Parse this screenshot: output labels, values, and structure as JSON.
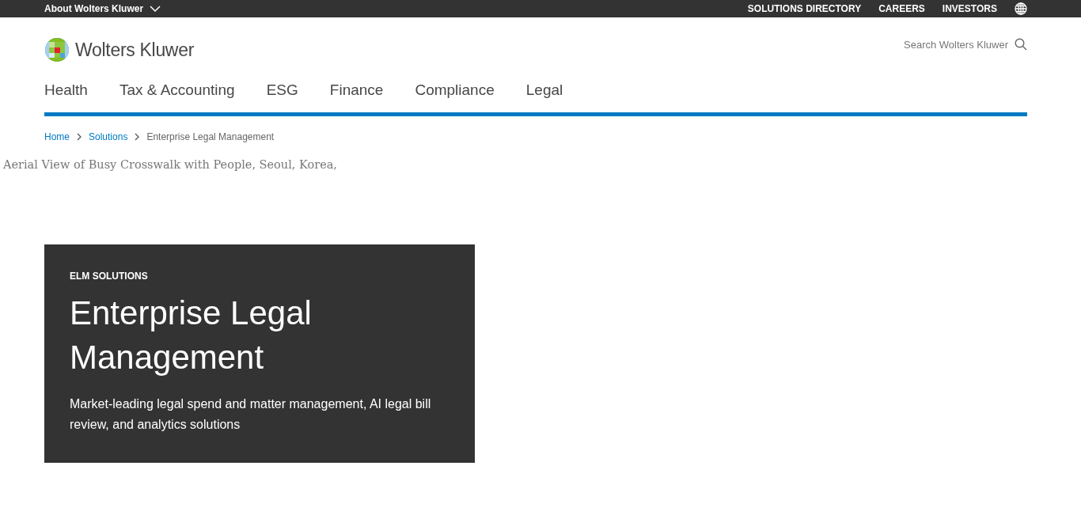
{
  "top_bar": {
    "about": "About Wolters Kluwer",
    "links": [
      "SOLUTIONS DIRECTORY",
      "CAREERS",
      "INVESTORS"
    ]
  },
  "header": {
    "logo_text": "Wolters Kluwer",
    "search": {
      "placeholder": "Search Wolters Kluwer"
    }
  },
  "nav": {
    "items": [
      "Health",
      "Tax & Accounting",
      "ESG",
      "Finance",
      "Compliance",
      "Legal"
    ]
  },
  "breadcrumb": [
    {
      "label": "Home",
      "kind": "link"
    },
    {
      "label": "Solutions",
      "kind": "link"
    },
    {
      "label": "Enterprise Legal Management",
      "kind": "current"
    }
  ],
  "image_alt": "Aerial View of Busy Crosswalk with People, Seoul, Korea,",
  "hero": {
    "eyebrow": "ELM SOLUTIONS",
    "title": "Enterprise Legal Management",
    "description": "Market-leading legal spend and matter management, AI legal bill review, and analytics solutions"
  }
}
